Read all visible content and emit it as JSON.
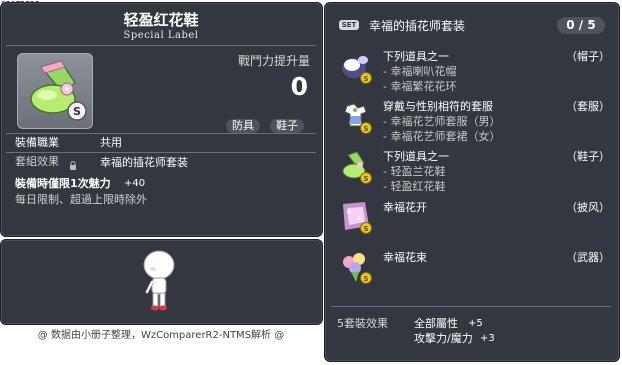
{
  "item_id": "01073899",
  "item": {
    "name": "轻盈红花鞋",
    "label": "Special Label",
    "power_label": "戰鬥力提升量",
    "power_value": "0",
    "tags": [
      "防具",
      "鞋子"
    ],
    "job_label": "裝備職業",
    "job_value": "共用",
    "set_label": "套組效果",
    "set_value": "幸福的插花师套装",
    "equip_bonus": "裝備時僅限1次魅力",
    "equip_bonus_value": "+40",
    "restriction": "每日限制、超過上限時除外"
  },
  "set": {
    "badge": "SET",
    "title": "幸福的插花师套装",
    "count": "0 / 5",
    "items": [
      {
        "name": "下列道具之一",
        "type": "（帽子）",
        "subs": [
          "- 幸福喇叭花帽",
          "- 幸福繁花花环"
        ],
        "icon": "hat-icon"
      },
      {
        "name": "穿戴与性别相符的套服",
        "type": "（套服）",
        "subs": [
          "- 幸福花艺师套服（男）",
          "- 幸福花艺师套裙（女）"
        ],
        "icon": "outfit-icon"
      },
      {
        "name": "下列道具之一",
        "type": "（鞋子）",
        "subs": [
          "- 轻盈兰花鞋",
          "- 轻盈红花鞋"
        ],
        "icon": "shoes-icon"
      },
      {
        "name": "幸福花开",
        "type": "（披风）",
        "subs": [],
        "icon": "cape-icon"
      },
      {
        "name": "幸福花束",
        "type": "（武器）",
        "subs": [],
        "icon": "bouquet-icon"
      }
    ],
    "effect_label": "5套裝效果",
    "effects": [
      {
        "name": "全部屬性",
        "value": "+5"
      },
      {
        "name": "攻擊力/魔力",
        "value": "+3"
      }
    ]
  },
  "footer": "@ 数据由小册子整理，WzComparerR2-NTMS解析 @",
  "colors": {
    "panel": "#33373f",
    "accent": "#ffffff",
    "coin": "#e8c72a"
  }
}
